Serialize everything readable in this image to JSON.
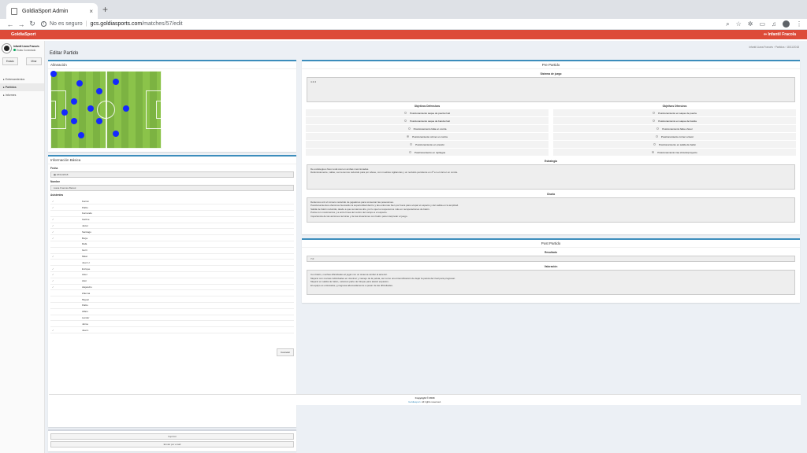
{
  "browser": {
    "tab_title": "GoldiaSport Admin",
    "tab_close": "×",
    "new_tab": "+",
    "security_label": "No es seguro",
    "url_host": "gcs.goldiasports.com",
    "url_path": "/matches/57/edit"
  },
  "appbar": {
    "brand": "GoldiaSport",
    "user_name": "Infantil Fracola"
  },
  "sidebar": {
    "user_name": "Infantil Liana Francés",
    "status": "Estas Conectado",
    "btn_left": "Estado",
    "btn_right": "Mirar",
    "items": [
      {
        "label": "Entrenamientos"
      },
      {
        "label": "Partidos"
      },
      {
        "label": "Informes"
      }
    ]
  },
  "page": {
    "title": "Editar Partido",
    "breadcrumb": "Infantil Liana Francés  ›  Partidos  ›  18/11/2018"
  },
  "alineacion": {
    "title": "Alineación"
  },
  "info": {
    "title": "Información Básica",
    "fecha_label": "Fecha",
    "fecha_value": "18/11/2018",
    "nombre_label": "Nombre",
    "nombre_value": "Liana Francés Barsol",
    "asistentes_label": "Asistentes",
    "asistentes": [
      {
        "mark": "✓",
        "name": "Ferran"
      },
      {
        "mark": "✓",
        "name": "Pablo"
      },
      {
        "mark": "",
        "name": "Fernando"
      },
      {
        "mark": "✓",
        "name": "Gaizne"
      },
      {
        "mark": "✓",
        "name": "Javier"
      },
      {
        "mark": "✓",
        "name": "Santiago"
      },
      {
        "mark": "✓",
        "name": "Borja"
      },
      {
        "mark": "",
        "name": "Rafa"
      },
      {
        "mark": "",
        "name": "Gorri"
      },
      {
        "mark": "✓",
        "name": "Mikel"
      },
      {
        "mark": "",
        "name": "Juan U."
      },
      {
        "mark": "✓",
        "name": "Enrique"
      },
      {
        "mark": "✓",
        "name": "Asier"
      },
      {
        "mark": "✓",
        "name": "Aitor"
      },
      {
        "mark": "✓",
        "name": "Alejandro"
      },
      {
        "mark": "",
        "name": "Zdenna"
      },
      {
        "mark": "",
        "name": "Miguel"
      },
      {
        "mark": "",
        "name": "Pablo"
      },
      {
        "mark": "",
        "name": "Alfaro"
      },
      {
        "mark": "",
        "name": "Lander"
      },
      {
        "mark": "",
        "name": "Jaime"
      },
      {
        "mark": "✓",
        "name": "Juan I."
      }
    ],
    "cancel_label": "Cancelar"
  },
  "actions": {
    "print_label": "Imprimir",
    "email_label": "Enviar por email"
  },
  "pre": {
    "title": "Pre Partido",
    "sistema_label": "Sistema de juego",
    "sistema_value": "4-3-3",
    "def_title": "Objetivos Defensivos",
    "off_title": "Objetivos Ofensivos",
    "def_items": [
      {
        "label": "Posicionamiento saque de puerta rival",
        "on": false
      },
      {
        "label": "Posicionamiento saque de banda rival",
        "on": false
      },
      {
        "label": "Posicionamiento falta en contra",
        "on": false
      },
      {
        "label": "Posicionamiento córner en contra",
        "on": true
      },
      {
        "label": "Posicionamiento en presión",
        "on": false
      },
      {
        "label": "Posicionamiento en repliegue",
        "on": false
      }
    ],
    "off_items": [
      {
        "label": "Posicionamiento en saque de puerta",
        "on": false
      },
      {
        "label": "Posicionamiento en saque de banda",
        "on": false
      },
      {
        "label": "Posicionamiento falta a favor",
        "on": false
      },
      {
        "label": "Posicionamiento córner a favor",
        "on": false
      },
      {
        "label": "Posicionamiento en salida de balón",
        "on": false
      },
      {
        "label": "Posicionamiento risa circuito/proyecto",
        "on": true
      }
    ],
    "estrategia_label": "Estrategia",
    "estrategia_value": "De estrategia a favor está casi en ambas mencionadas.\nDefensivamente, vallas, van tenemos reducido para por abuse, con muebles vigilancias y un recluido pendiente en 2ª en el córner en contra.",
    "charla_label": "Charla",
    "charla_value": "Debemos unir el número reducido de jugadores para conservar las posesiones.\nPosicionamientos ofensivos buscando la superioridad dentro y las extremas bien por fuera para ocupar el espacio y dar salida en la amplitud.\nSalida de balón reducida, desde a que sumamos alto, por lo que la cooperemos más en recuperaciones de balón.\nPunta con movimientos y a entre línea del centro del campo a el espacio.\nImportancia de las acciones técnicas y de las situaciones con balón para interpretar el juego."
  },
  "post": {
    "title": "Post Partido",
    "resultado_label": "Resultado",
    "resultado_value": "7-0",
    "valoracion_label": "Valoración",
    "valoracion_value": "Con balón, muchas dificultades al jugar con un sistema similar al anterior.\nMejorar con marcas individuales en dominar y manejo de la pelota, así como una intensificación de dejar la pelota del rival para progresar.\nMejorar en salida de balón, estamos parte de bloque para atacar espacios.\nEl equipo es entusiasta y progresa adecuadamente a pesar de las dificultades."
  },
  "footer": {
    "copyright": "Copyright © 2018",
    "brand_link": "Goldiasport",
    "rights": ". All rights reserved."
  },
  "colors": {
    "header": "#dd4b39",
    "box_accent": "#3c8dbc",
    "player": "#1428ff",
    "pitch": "#8bc34a"
  }
}
